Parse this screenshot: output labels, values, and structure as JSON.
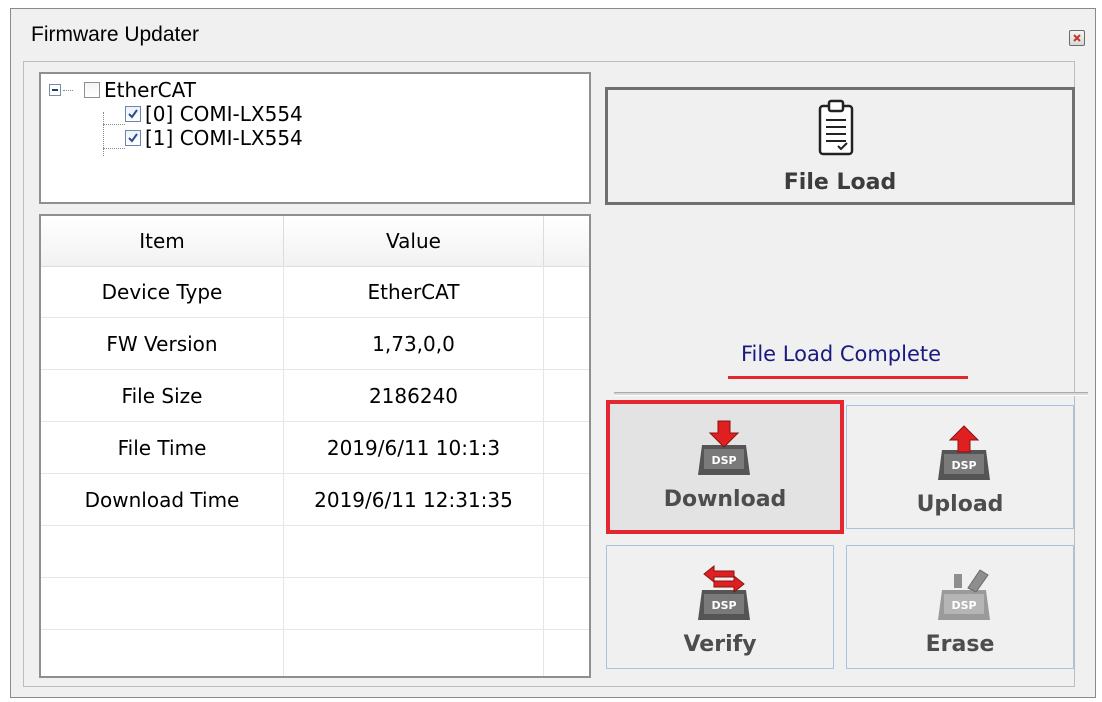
{
  "window": {
    "title": "Firmware Updater"
  },
  "tree": {
    "root": {
      "label": "EtherCAT",
      "checked": false
    },
    "children": [
      {
        "label": "[0] COMI-LX554",
        "checked": true
      },
      {
        "label": "[1] COMI-LX554",
        "checked": true
      }
    ]
  },
  "table": {
    "headers": [
      "Item",
      "Value"
    ],
    "rows": [
      [
        "Device Type",
        "EtherCAT"
      ],
      [
        "FW Version",
        "1,73,0,0"
      ],
      [
        "File Size",
        "2186240"
      ],
      [
        "File Time",
        "2019/6/11 10:1:3"
      ],
      [
        "Download Time",
        "2019/6/11 12:31:35"
      ],
      [
        "",
        ""
      ],
      [
        "",
        ""
      ],
      [
        "",
        ""
      ]
    ]
  },
  "file_load": {
    "label": "File Load"
  },
  "status": {
    "text": "File Load Complete"
  },
  "actions": {
    "download": "Download",
    "upload": "Upload",
    "verify": "Verify",
    "erase": "Erase",
    "dsp_text": "DSP"
  },
  "colors": {
    "highlight": "#e3262f",
    "status_text": "#1a1a7e",
    "arrow_red": "#e02020"
  }
}
